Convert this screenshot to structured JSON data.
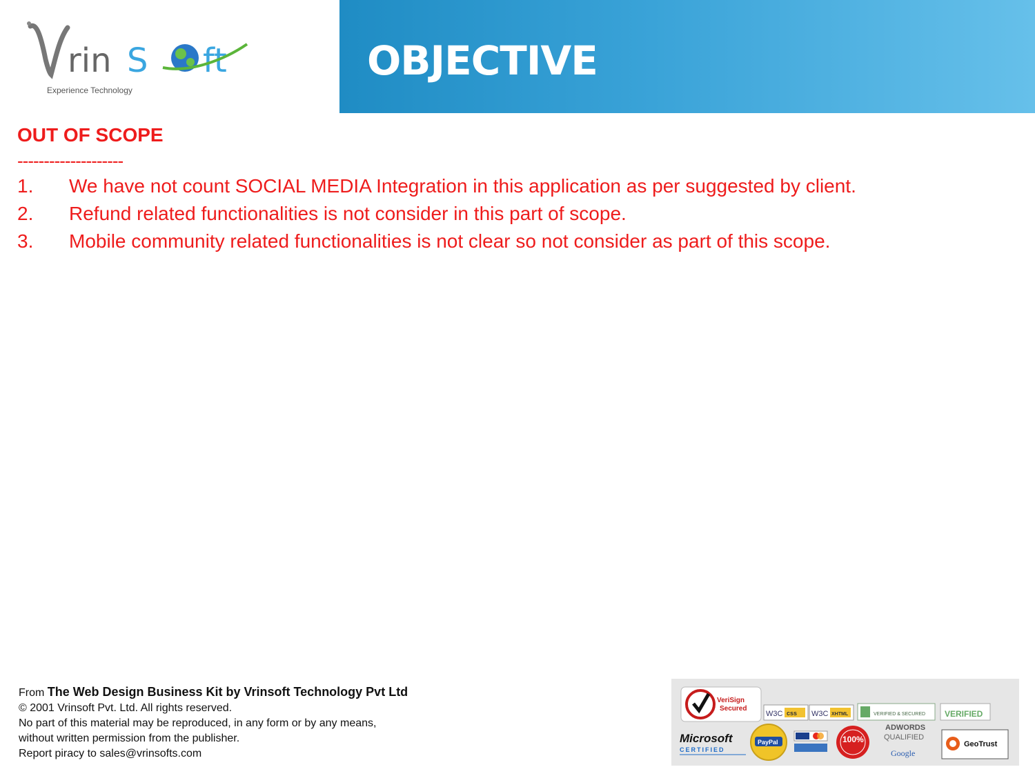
{
  "header": {
    "logo_text": "VrinSoft",
    "logo_tagline": "Experience Technology",
    "title": "OBJECTIVE"
  },
  "content": {
    "heading": "OUT OF SCOPE",
    "separator": "--------------------",
    "items": [
      {
        "num": "1.",
        "text": "We have not count SOCIAL MEDIA Integration in this application as per suggested by client."
      },
      {
        "num": "2.",
        "text": "Refund related functionalities is not consider in this part of scope."
      },
      {
        "num": "3.",
        "text": "Mobile community related functionalities is not clear so not consider as part of this scope."
      }
    ]
  },
  "footer": {
    "from_prefix": "From ",
    "from_title": "The Web Design Business Kit by Vrinsoft Technology Pvt Ltd",
    "copyright": "© 2001 Vrinsoft Pvt. Ltd. All rights reserved.",
    "notice_line1": "No part of this material may be reproduced, in any form or by any means,",
    "notice_line2": "without written permission from the publisher.",
    "piracy": "Report piracy to sales@vrinsofts.com"
  },
  "badges": {
    "verisign": "VeriSign Secured",
    "w3c_css": "W3C css",
    "w3c_xhtml": "W3C XHTML 1.0",
    "godaddy": "VERIFIED & SECURED",
    "fifthcommerce": "VERIFIED",
    "microsoft": "Microsoft",
    "microsoft_sub": "CERTIFIED",
    "paypal": "PayPal",
    "percent": "100%",
    "adwords": "ADWORDS",
    "qualified": "QUALIFIED",
    "google": "Google",
    "geotrust": "GeoTrust"
  },
  "colors": {
    "accent_red": "#ee1c1c",
    "banner_blue": "#1f8cc4"
  }
}
